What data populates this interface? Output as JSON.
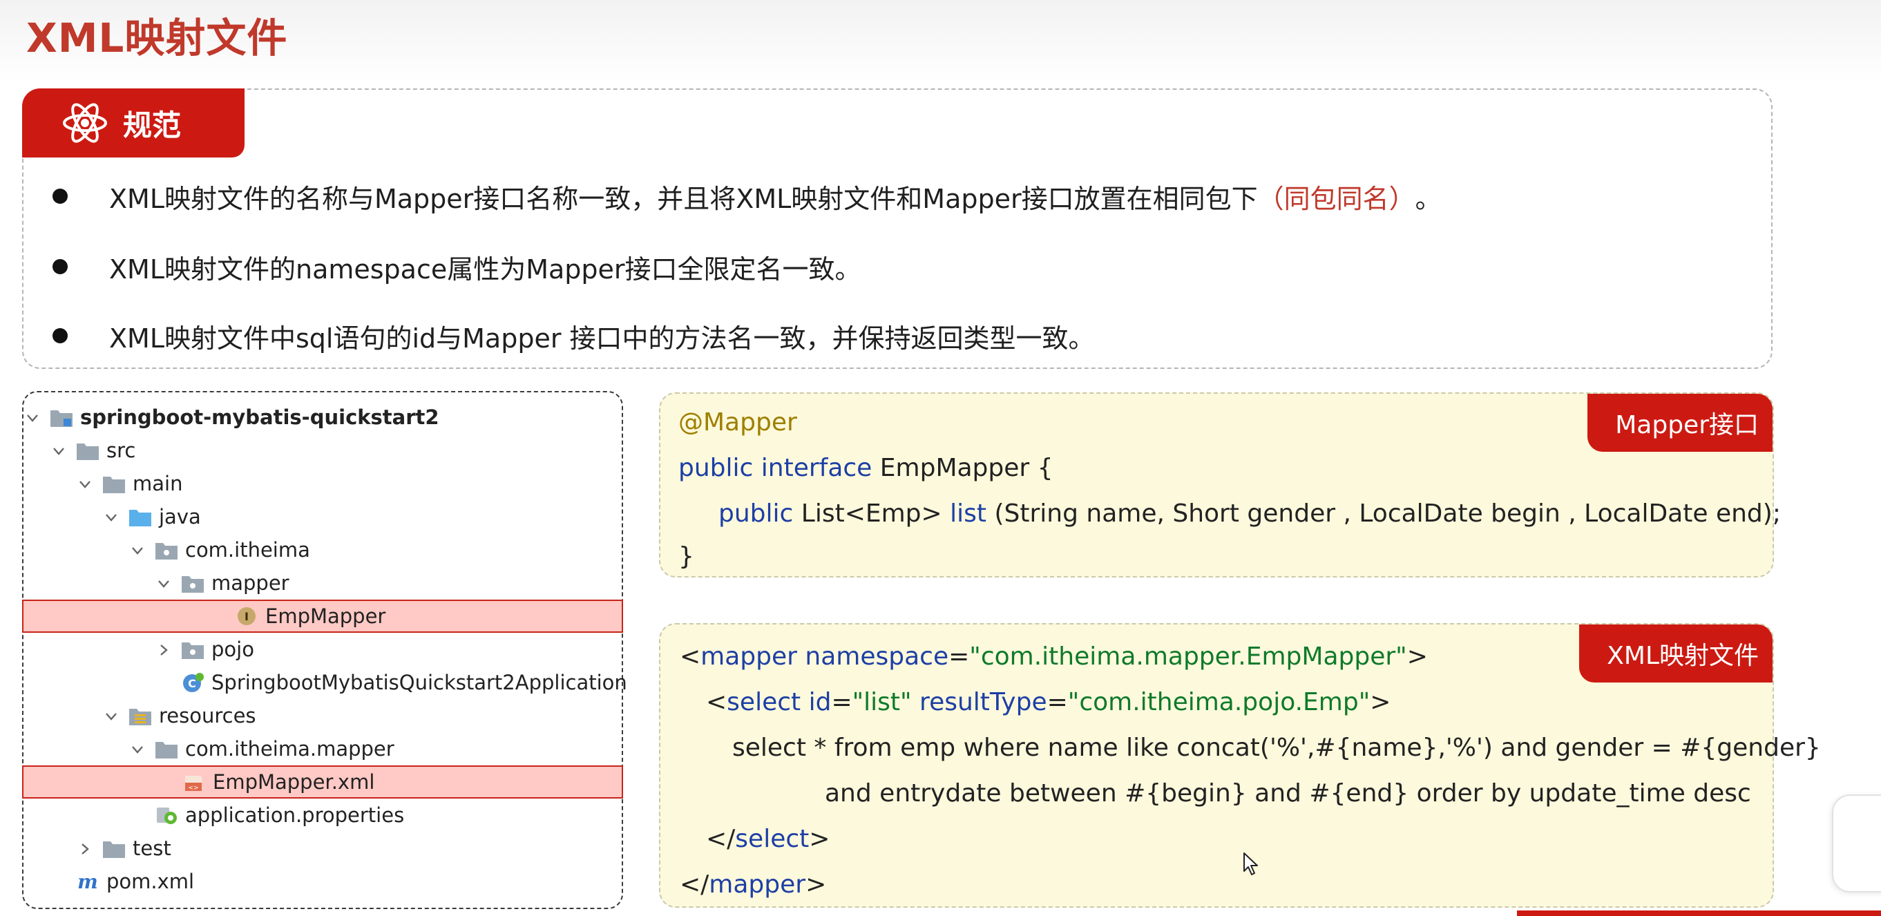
{
  "page": {
    "title": "XML映射文件"
  },
  "rules": {
    "badge_label": "规范",
    "items": [
      {
        "before": "XML映射文件的名称与Mapper接口名称一致，并且将XML映射文件和Mapper接口放置在相同包下",
        "highlight": "（同包同名）",
        "after": "。"
      },
      {
        "before": "XML映射文件的namespace属性为Mapper接口全限定名一致。",
        "highlight": "",
        "after": ""
      },
      {
        "before": "XML映射文件中sql语句的id与Mapper 接口中的方法名一致，并保持返回类型一致。",
        "highlight": "",
        "after": ""
      }
    ]
  },
  "tree": {
    "items": [
      {
        "label": "springboot-mybatis-quickstart2",
        "icon": "module-folder-icon",
        "expand": "open"
      },
      {
        "label": "src",
        "icon": "folder-icon",
        "expand": "open"
      },
      {
        "label": "main",
        "icon": "folder-icon",
        "expand": "open"
      },
      {
        "label": "java",
        "icon": "source-folder-icon",
        "expand": "open"
      },
      {
        "label": "com.itheima",
        "icon": "package-icon",
        "expand": "open"
      },
      {
        "label": "mapper",
        "icon": "package-icon",
        "expand": "open"
      },
      {
        "label": "EmpMapper",
        "icon": "interface-icon",
        "expand": "none",
        "selected": true
      },
      {
        "label": "pojo",
        "icon": "package-icon",
        "expand": "closed"
      },
      {
        "label": "SpringbootMybatisQuickstart2Application",
        "icon": "spring-class-icon",
        "expand": "none"
      },
      {
        "label": "resources",
        "icon": "resources-folder-icon",
        "expand": "open"
      },
      {
        "label": "com.itheima.mapper",
        "icon": "folder-icon",
        "expand": "open"
      },
      {
        "label": "EmpMapper.xml",
        "icon": "xml-file-icon",
        "expand": "none",
        "selected": true
      },
      {
        "label": "application.properties",
        "icon": "properties-file-icon",
        "expand": "none"
      },
      {
        "label": "test",
        "icon": "folder-icon",
        "expand": "closed"
      },
      {
        "label": "pom.xml",
        "icon": "maven-icon",
        "expand": "none"
      }
    ]
  },
  "mapper_panel": {
    "badge": "Mapper接口",
    "annotation": "@Mapper",
    "decl_kw": "public interface",
    "decl_name": " EmpMapper {",
    "method_kw": "public",
    "method_type": " List<Emp> ",
    "method_name": "list",
    "method_params": " (String name, Short gender , LocalDate begin , LocalDate end);",
    "closing": "}"
  },
  "xml_panel": {
    "badge": "XML映射文件",
    "mapper_open": {
      "lt": "<",
      "tag": "mapper",
      "attr": " namespace",
      "eq": "=",
      "val": "\"com.itheima.mapper.EmpMapper\"",
      "gt": ">"
    },
    "select_open": {
      "lt": "<",
      "tag": "select",
      "attr1": " id",
      "eq1": "=",
      "val1": "\"list\"",
      "attr2": " resultType",
      "eq2": "=",
      "val2": "\"com.itheima.pojo.Emp\"",
      "gt": ">"
    },
    "sql_line1": "select * from emp where name like concat('%',#{name},'%') and gender = #{gender}",
    "sql_line2": "and entrydate between #{begin} and #{end} order by update_time desc",
    "select_close": {
      "lt": "</",
      "tag": "select",
      "gt": ">"
    },
    "mapper_close": {
      "lt": "</",
      "tag": "mapper",
      "gt": ">"
    }
  },
  "colors": {
    "accent": "#cc1a12",
    "title": "#c0392b",
    "code_bg": "#fdf9dc",
    "selected_row": "#ffc9c5",
    "keyword": "#1d3fa5",
    "string": "#0e7a2a",
    "annotation": "#9e7f00"
  }
}
